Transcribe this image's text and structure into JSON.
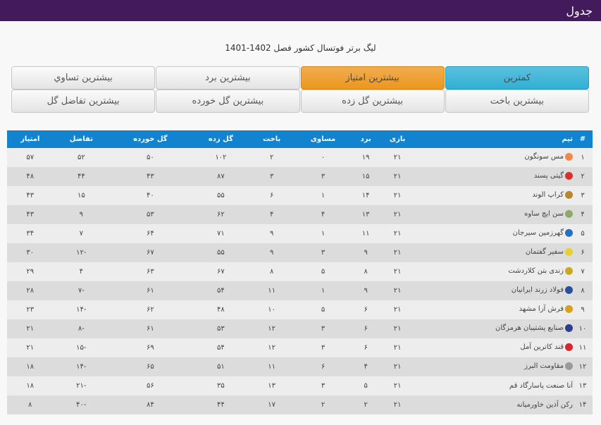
{
  "header": {
    "title": "جدول"
  },
  "subtitle": "لیگ برتر فوتسال کشور فصل 1402-1401",
  "buttons": [
    {
      "label": "کمترین",
      "style": "blue"
    },
    {
      "label": "بیشترین امتیاز",
      "style": "orange"
    },
    {
      "label": "بیشترین برد",
      "style": "default"
    },
    {
      "label": "بیشترین تساوي",
      "style": "default"
    },
    {
      "label": "بیشترین باخت",
      "style": "default"
    },
    {
      "label": "بیشترین گل زده",
      "style": "default"
    },
    {
      "label": "بیشترین گل خورده",
      "style": "default"
    },
    {
      "label": "بیشترین تفاضل گل",
      "style": "default"
    }
  ],
  "table": {
    "columns": [
      "#",
      "تیم",
      "بازی",
      "برد",
      "مساوی",
      "باخت",
      "گل زده",
      "گل خورده",
      "تفاضل",
      "امتیاز"
    ],
    "rows": [
      {
        "rank": "۱",
        "team": "مس سونگون",
        "logo": "#f08a4b",
        "played": "۲۱",
        "won": "۱۹",
        "drawn": "۰",
        "lost": "۲",
        "gf": "۱۰۲",
        "ga": "۵۰",
        "gd": "۵۲",
        "pts": "۵۷"
      },
      {
        "rank": "۲",
        "team": "گیتی پسند",
        "logo": "#d8302a",
        "played": "۲۱",
        "won": "۱۵",
        "drawn": "۳",
        "lost": "۳",
        "gf": "۸۷",
        "ga": "۴۳",
        "gd": "۴۴",
        "pts": "۴۸"
      },
      {
        "rank": "۳",
        "team": "کراپ الوند",
        "logo": "#b8862b",
        "played": "۲۱",
        "won": "۱۴",
        "drawn": "۱",
        "lost": "۶",
        "gf": "۵۵",
        "ga": "۴۰",
        "gd": "۱۵",
        "pts": "۴۳"
      },
      {
        "rank": "۴",
        "team": "سن ایچ ساوه",
        "logo": "#8fa86a",
        "played": "۲۱",
        "won": "۱۳",
        "drawn": "۴",
        "lost": "۴",
        "gf": "۶۲",
        "ga": "۵۳",
        "gd": "۹",
        "pts": "۴۳"
      },
      {
        "rank": "۵",
        "team": "گهرزمین سیرجان",
        "logo": "#2a6fc0",
        "played": "۲۱",
        "won": "۱۱",
        "drawn": "۱",
        "lost": "۹",
        "gf": "۷۱",
        "ga": "۶۴",
        "gd": "۷",
        "pts": "۳۴"
      },
      {
        "rank": "۶",
        "team": "سفیر گفتمان",
        "logo": "#e8d030",
        "played": "۲۱",
        "won": "۹",
        "drawn": "۳",
        "lost": "۹",
        "gf": "۵۵",
        "ga": "۶۷",
        "gd": "-۱۲",
        "pts": "۳۰"
      },
      {
        "rank": "۷",
        "team": "زندی بتن کلاردشت",
        "logo": "#c9a826",
        "played": "۲۱",
        "won": "۸",
        "drawn": "۵",
        "lost": "۸",
        "gf": "۶۷",
        "ga": "۶۳",
        "gd": "۴",
        "pts": "۲۹"
      },
      {
        "rank": "۸",
        "team": "فولاد زرند ایرانیان",
        "logo": "#2a4f9a",
        "played": "۲۱",
        "won": "۹",
        "drawn": "۱",
        "lost": "۱۱",
        "gf": "۵۴",
        "ga": "۶۱",
        "gd": "-۷",
        "pts": "۲۸"
      },
      {
        "rank": "۹",
        "team": "فرش آرا مشهد",
        "logo": "#d4a21c",
        "played": "۲۱",
        "won": "۶",
        "drawn": "۵",
        "lost": "۱۰",
        "gf": "۴۸",
        "ga": "۶۲",
        "gd": "-۱۴",
        "pts": "۲۳"
      },
      {
        "rank": "۱۰",
        "team": "صنایع پشتیبان هرمزگان",
        "logo": "#2b3f8c",
        "played": "۲۱",
        "won": "۶",
        "drawn": "۳",
        "lost": "۱۲",
        "gf": "۵۳",
        "ga": "۶۱",
        "gd": "-۸",
        "pts": "۲۱"
      },
      {
        "rank": "۱۱",
        "team": "قند کاترین آمل",
        "logo": "#d9262b",
        "played": "۲۱",
        "won": "۶",
        "drawn": "۳",
        "lost": "۱۲",
        "gf": "۵۴",
        "ga": "۶۹",
        "gd": "-۱۵",
        "pts": "۲۱"
      },
      {
        "rank": "۱۲",
        "team": "مقاومت البرز",
        "logo": "#9a9a9a",
        "played": "۲۱",
        "won": "۴",
        "drawn": "۶",
        "lost": "۱۱",
        "gf": "۵۱",
        "ga": "۶۵",
        "gd": "-۱۴",
        "pts": "۱۸"
      },
      {
        "rank": "۱۳",
        "team": "آنا صنعت پاسارگاد قم",
        "logo": "",
        "played": "۲۱",
        "won": "۵",
        "drawn": "۳",
        "lost": "۱۳",
        "gf": "۳۵",
        "ga": "۵۶",
        "gd": "-۲۱",
        "pts": "۱۸"
      },
      {
        "rank": "۱۴",
        "team": "رکن آذین خاورمیانه",
        "logo": "",
        "played": "۲۱",
        "won": "۲",
        "drawn": "۲",
        "lost": "۱۷",
        "gf": "۴۴",
        "ga": "۸۴",
        "gd": "-۴۰",
        "pts": "۸"
      }
    ]
  }
}
